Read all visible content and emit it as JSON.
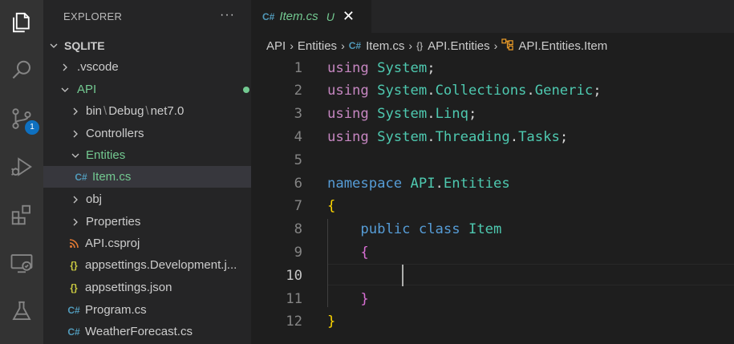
{
  "activity_bar": {
    "icons": [
      "explorer-icon",
      "search-icon",
      "source-control-icon",
      "run-debug-icon",
      "extensions-icon",
      "remote-explorer-icon",
      "testing-icon"
    ],
    "source_control_badge": "1",
    "accent": "#0e70c0"
  },
  "explorer": {
    "title": "EXPLORER",
    "more": "···",
    "workspace": "SQLITE",
    "tree": [
      {
        "label": ".vscode",
        "kind": "folder",
        "expanded": false
      },
      {
        "label": "API",
        "kind": "folder",
        "expanded": true,
        "modified_dot": true
      },
      {
        "label": "bin",
        "kind": "folder",
        "expanded": false,
        "path_parts": [
          "bin",
          "Debug",
          "net7.0"
        ]
      },
      {
        "label": "Controllers",
        "kind": "folder",
        "expanded": false
      },
      {
        "label": "Entities",
        "kind": "folder",
        "expanded": true,
        "modified_dot": true
      },
      {
        "label": "Item.cs",
        "kind": "file",
        "icon": "csharp-icon",
        "status": "U",
        "selected": true
      },
      {
        "label": "obj",
        "kind": "folder",
        "expanded": false
      },
      {
        "label": "Properties",
        "kind": "folder",
        "expanded": false
      },
      {
        "label": "API.csproj",
        "kind": "file",
        "icon": "rss-icon"
      },
      {
        "label": "appsettings.Development.j...",
        "kind": "file",
        "icon": "json-icon"
      },
      {
        "label": "appsettings.json",
        "kind": "file",
        "icon": "json-icon"
      },
      {
        "label": "Program.cs",
        "kind": "file",
        "icon": "csharp-icon"
      },
      {
        "label": "WeatherForecast.cs",
        "kind": "file",
        "icon": "csharp-icon"
      }
    ],
    "path_separator": "\\",
    "icon_glyphs": {
      "csharp": "C#",
      "json": "{}"
    }
  },
  "tab": {
    "label": "Item.cs",
    "status": "U",
    "close": "✕"
  },
  "breadcrumb": {
    "items": [
      "API",
      "Entities",
      "Item.cs",
      "API.Entities",
      "API.Entities.Item"
    ],
    "namespace_icon": "{}"
  },
  "code": {
    "lines": [
      {
        "n": "1",
        "tokens": [
          [
            "k1",
            "using"
          ],
          [
            "pl",
            " "
          ],
          [
            "ns",
            "System"
          ],
          [
            "pl",
            ";"
          ]
        ]
      },
      {
        "n": "2",
        "tokens": [
          [
            "k1",
            "using"
          ],
          [
            "pl",
            " "
          ],
          [
            "ns",
            "System"
          ],
          [
            "pl",
            "."
          ],
          [
            "ns",
            "Collections"
          ],
          [
            "pl",
            "."
          ],
          [
            "ns",
            "Generic"
          ],
          [
            "pl",
            ";"
          ]
        ]
      },
      {
        "n": "3",
        "tokens": [
          [
            "k1",
            "using"
          ],
          [
            "pl",
            " "
          ],
          [
            "ns",
            "System"
          ],
          [
            "pl",
            "."
          ],
          [
            "ns",
            "Linq"
          ],
          [
            "pl",
            ";"
          ]
        ]
      },
      {
        "n": "4",
        "tokens": [
          [
            "k1",
            "using"
          ],
          [
            "pl",
            " "
          ],
          [
            "ns",
            "System"
          ],
          [
            "pl",
            "."
          ],
          [
            "ns",
            "Threading"
          ],
          [
            "pl",
            "."
          ],
          [
            "ns",
            "Tasks"
          ],
          [
            "pl",
            ";"
          ]
        ]
      },
      {
        "n": "5",
        "tokens": []
      },
      {
        "n": "6",
        "tokens": [
          [
            "kw",
            "namespace"
          ],
          [
            "pl",
            " "
          ],
          [
            "nsn",
            "API"
          ],
          [
            "pl",
            "."
          ],
          [
            "nsn",
            "Entities"
          ]
        ]
      },
      {
        "n": "7",
        "tokens": [
          [
            "br1",
            "{"
          ]
        ]
      },
      {
        "n": "8",
        "tokens": [
          [
            "pl",
            "    "
          ],
          [
            "kw",
            "public"
          ],
          [
            "pl",
            " "
          ],
          [
            "kw",
            "class"
          ],
          [
            "pl",
            " "
          ],
          [
            "ns",
            "Item"
          ]
        ]
      },
      {
        "n": "9",
        "tokens": [
          [
            "pl",
            "    "
          ],
          [
            "br2",
            "{"
          ]
        ]
      },
      {
        "n": "10",
        "tokens": [],
        "active": true
      },
      {
        "n": "11",
        "tokens": [
          [
            "pl",
            "    "
          ],
          [
            "br2",
            "}"
          ]
        ]
      },
      {
        "n": "12",
        "tokens": [
          [
            "br1",
            "}"
          ]
        ]
      }
    ]
  }
}
